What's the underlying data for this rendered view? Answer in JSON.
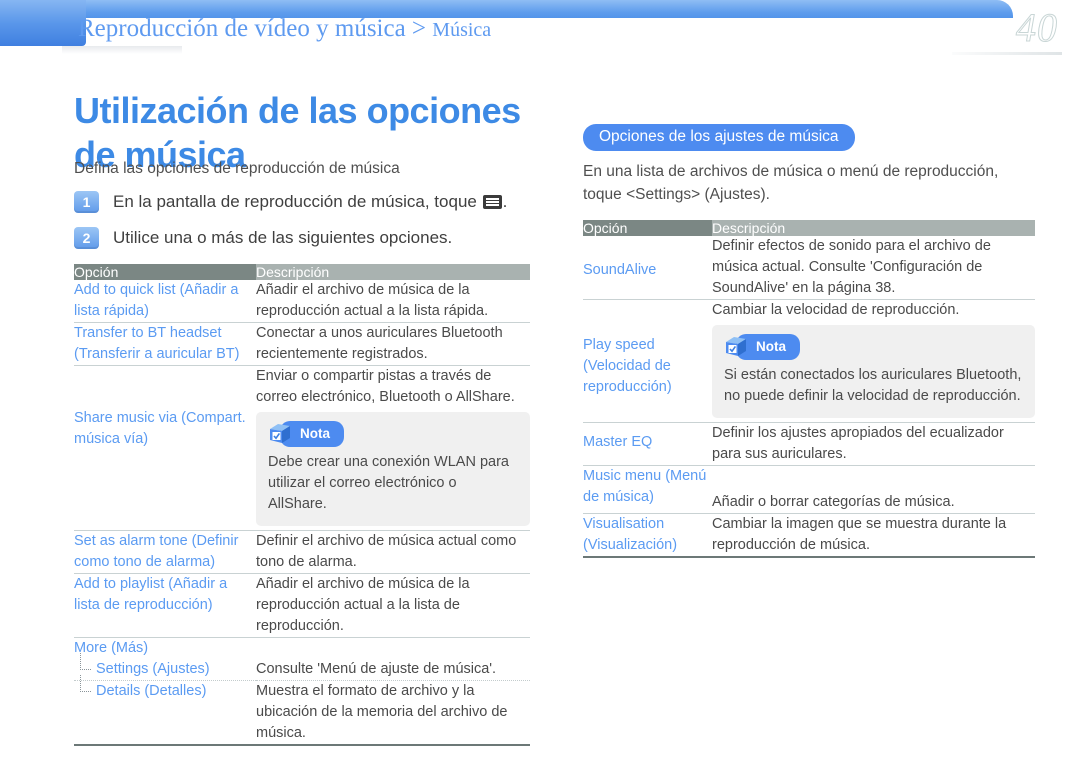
{
  "page": {
    "number": "40",
    "breadcrumb_main": "Reproducción de vídeo y música > ",
    "breadcrumb_sub": "Música",
    "title": "Utilización de las opciones de música",
    "intro": "Defina las opciones de reproducción de música"
  },
  "steps": [
    {
      "num": "1",
      "text_before": "En la pantalla de reproducción de música, toque ",
      "icon": "menu-icon",
      "text_after": "."
    },
    {
      "num": "2",
      "text_before": "Utilice una o más de las siguientes opciones.",
      "icon": "",
      "text_after": ""
    }
  ],
  "left_table": {
    "header": {
      "option": "Opción",
      "description": "Descripción"
    },
    "rows": [
      {
        "option": "Add to quick list (Añadir a lista rápida)",
        "description": "Añadir el archivo de música de la reproducción actual a la lista rápida."
      },
      {
        "option": "Transfer to BT headset (Transferir a auricular BT)",
        "description": "Conectar a unos auriculares Bluetooth recientemente registrados."
      },
      {
        "option": "",
        "description": "Enviar o compartir pistas a través de correo electrónico, Bluetooth o AllShare."
      },
      {
        "option": "Share music via (Compart. música vía)",
        "description": "",
        "note": {
          "label": "Nota",
          "body": "Debe crear una conexión WLAN para utilizar el correo electrónico o AllShare."
        }
      },
      {
        "option": "Set as alarm tone (Definir como tono de alarma)",
        "description": "Definir el archivo de música actual como tono de alarma."
      },
      {
        "option": "Add to playlist (Añadir a lista de reproducción)",
        "description": "Añadir el archivo de música de la reproducción actual a la lista de reproducción."
      },
      {
        "option": "More (Más)",
        "description": "",
        "children": [
          {
            "option": "Settings (Ajustes)",
            "description": "Consulte 'Menú de ajuste de música'."
          },
          {
            "option": "Details (Detalles)",
            "description": "Muestra el formato de archivo y la ubicación de la memoria del archivo de música."
          }
        ]
      }
    ]
  },
  "section": {
    "badge": "Opciones de los ajustes de música",
    "intro": "En una lista de archivos de música o menú de reproducción, toque <Settings> (Ajustes)."
  },
  "right_table": {
    "header": {
      "option": "Opción",
      "description": "Descripción"
    },
    "rows": [
      {
        "option": "SoundAlive",
        "description": "Definir efectos de sonido para el archivo de música actual. Consulte 'Configuración de SoundAlive' en la página 38."
      },
      {
        "option": "",
        "description": "Cambiar la velocidad de reproducción."
      },
      {
        "option": "Play speed (Velocidad de reproducción)",
        "description": "",
        "note": {
          "label": "Nota",
          "body": "Si están conectados los auriculares Bluetooth, no puede definir la velocidad de reproducción."
        }
      },
      {
        "option": "Master EQ",
        "description": "Definir los ajustes apropiados del ecualizador para sus auriculares."
      },
      {
        "option": "Music menu (Menú de música)",
        "description": "Añadir o borrar categorías de música."
      },
      {
        "option": "Visualisation (Visualización)",
        "description": "Cambiar la imagen que se muestra durante la reproducción de música."
      }
    ]
  },
  "colors": {
    "accent_blue": "#4d8bf0",
    "link_blue": "#5b9bf2",
    "title_blue": "#3d8ae5",
    "header_dark": "#7b8784",
    "header_light": "#a9b2b0",
    "body_text": "#4a4a4a"
  }
}
